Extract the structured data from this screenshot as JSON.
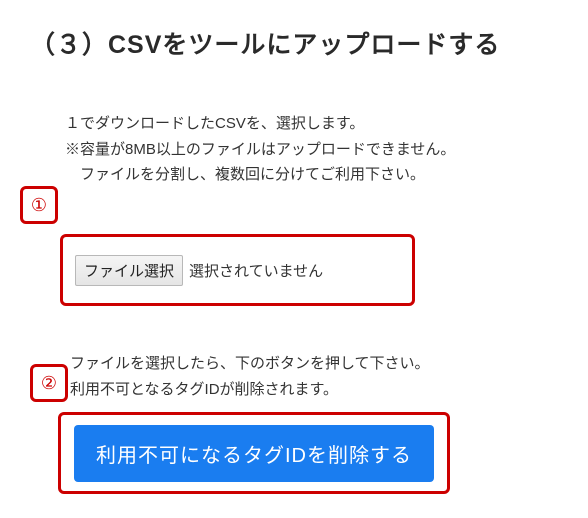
{
  "heading": "（３）CSVをツールにアップロードする",
  "description": {
    "line1": "１でダウンロードしたCSVを、選択します。",
    "line2": "※容量が8MB以上のファイルはアップロードできません。",
    "line3": "　ファイルを分割し、複数回に分けてご利用下さい。"
  },
  "badges": {
    "one": "①",
    "two": "②"
  },
  "file_chooser": {
    "button_label": "ファイル選択",
    "status_text": "選択されていません"
  },
  "description2": {
    "line1": "ファイルを選択したら、下のボタンを押して下さい。",
    "line2": "利用不可となるタグIDが削除されます。"
  },
  "submit": {
    "label": "利用不可になるタグIDを削除する"
  }
}
